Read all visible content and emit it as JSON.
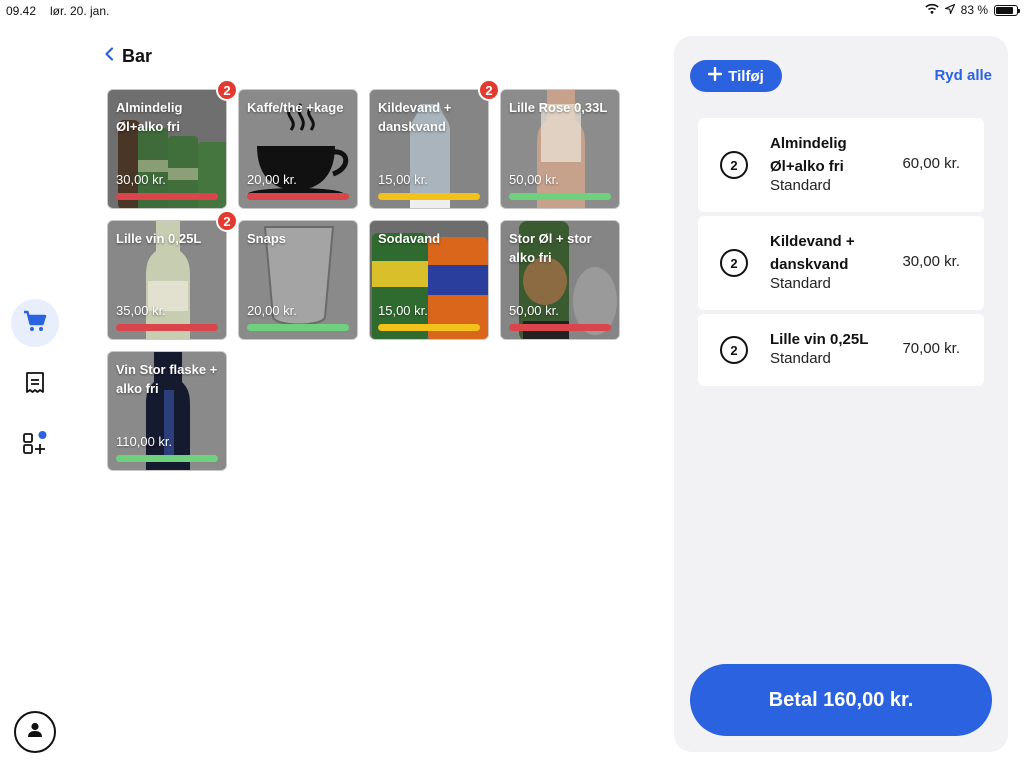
{
  "status": {
    "time": "09.42",
    "date": "lør. 20. jan.",
    "battery": "83 %",
    "battery_level": 0.83
  },
  "header": {
    "title": "Bar"
  },
  "colors": {
    "accent": "#2b62df",
    "red": "#d9454a",
    "yellow": "#f2c21b",
    "green": "#6fd17d",
    "badge": "#e23a2e"
  },
  "products": [
    {
      "name": "Almindelig Øl+alko fri",
      "price": "30,00 kr.",
      "stock": "red",
      "badge": "2"
    },
    {
      "name": "Kaffe/the +kage",
      "price": "20,00 kr.",
      "stock": "red",
      "badge": ""
    },
    {
      "name": "Kildevand + danskvand",
      "price": "15,00 kr.",
      "stock": "yellow",
      "badge": "2"
    },
    {
      "name": "Lille Rose 0,33L",
      "price": "50,00 kr.",
      "stock": "green",
      "badge": ""
    },
    {
      "name": "Lille vin 0,25L",
      "price": "35,00 kr.",
      "stock": "red",
      "badge": "2"
    },
    {
      "name": "Snaps",
      "price": "20,00 kr.",
      "stock": "green",
      "badge": ""
    },
    {
      "name": "Sodavand",
      "price": "15,00 kr.",
      "stock": "yellow",
      "badge": ""
    },
    {
      "name": "Stor Øl + stor alko fri",
      "price": "50,00 kr.",
      "stock": "red",
      "badge": ""
    },
    {
      "name": "Vin Stor flaske + alko fri",
      "price": "110,00 kr.",
      "stock": "green",
      "badge": ""
    }
  ],
  "cart": {
    "add_label": "Tilføj",
    "clear_label": "Ryd alle",
    "lines": [
      {
        "qty": "2",
        "name": "Almindelig Øl+alko fri",
        "variant": "Standard",
        "price": "60,00 kr."
      },
      {
        "qty": "2",
        "name": "Kildevand + danskvand",
        "variant": "Standard",
        "price": "30,00 kr."
      },
      {
        "qty": "2",
        "name": "Lille vin 0,25L",
        "variant": "Standard",
        "price": "70,00 kr."
      }
    ],
    "pay_label": "Betal 160,00 kr."
  },
  "icons": [
    "chevron-left-icon",
    "cart-icon",
    "receipt-icon",
    "apps-add-icon",
    "user-icon",
    "wifi-icon",
    "location-arrow-icon",
    "battery-icon",
    "plus-icon"
  ]
}
